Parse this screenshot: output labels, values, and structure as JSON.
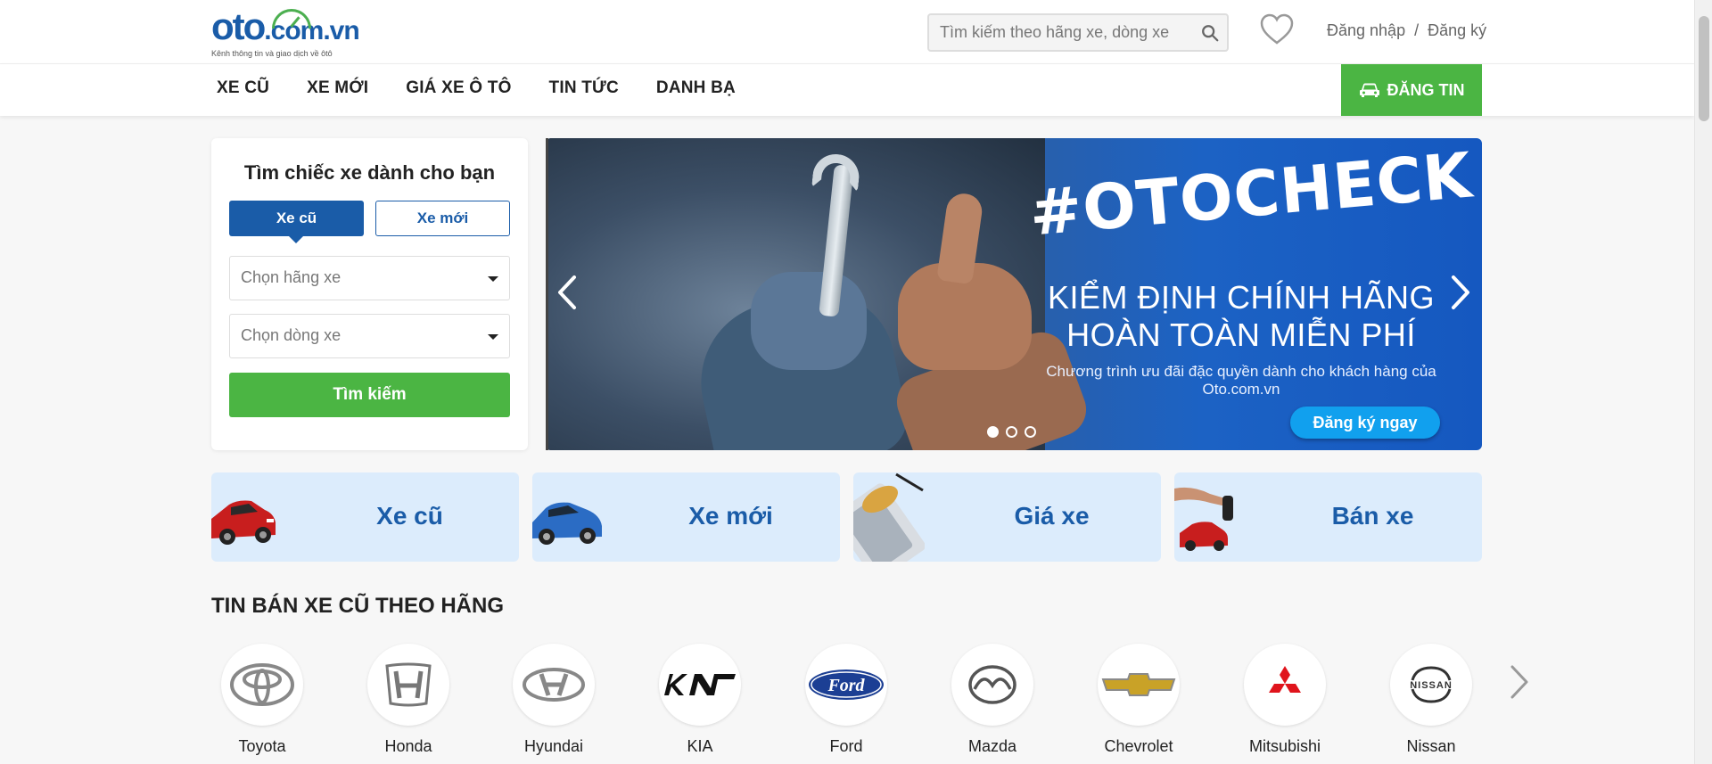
{
  "header": {
    "logo_text": "oto",
    "logo_domain": ".com.vn",
    "logo_tagline": "Kênh thông tin và giao dịch về ôtô",
    "search_placeholder": "Tìm kiếm theo hãng xe, dòng xe",
    "login": "Đăng nhập",
    "separator": "/",
    "register": "Đăng ký"
  },
  "nav": {
    "items": [
      "XE CŨ",
      "XE MỚI",
      "GIÁ XE Ô TÔ",
      "TIN TỨC",
      "DANH BẠ"
    ],
    "post_label": "ĐĂNG TIN"
  },
  "search_panel": {
    "title": "Tìm chiếc xe dành cho bạn",
    "tab_used": "Xe cũ",
    "tab_new": "Xe mới",
    "brand_placeholder": "Chọn hãng xe",
    "model_placeholder": "Chọn dòng xe",
    "button": "Tìm kiếm"
  },
  "banner": {
    "title": "#OTOCHECK",
    "line1": "KIỂM ĐỊNH CHÍNH HÃNG",
    "line2": "HOÀN TOÀN MIỄN PHÍ",
    "subtitle1": "Chương trình ưu đãi đặc quyền dành cho khách hàng của",
    "subtitle2": "Oto.com.vn",
    "cta": "Đăng ký ngay",
    "slides": 3,
    "active_slide": 1
  },
  "categories": [
    {
      "label": "Xe cũ",
      "icon": "red-car"
    },
    {
      "label": "Xe mới",
      "icon": "blue-car"
    },
    {
      "label": "Giá xe",
      "icon": "calculator-car"
    },
    {
      "label": "Bán xe",
      "icon": "key-car"
    }
  ],
  "brands_section": {
    "title": "TIN BÁN XE CŨ THEO HÃNG",
    "brands": [
      "Toyota",
      "Honda",
      "Hyundai",
      "KIA",
      "Ford",
      "Mazda",
      "Chevrolet",
      "Mitsubishi",
      "Nissan"
    ]
  },
  "colors": {
    "brand_blue": "#1a5ca8",
    "green": "#4bb543",
    "card_bg": "#dcecfc"
  }
}
